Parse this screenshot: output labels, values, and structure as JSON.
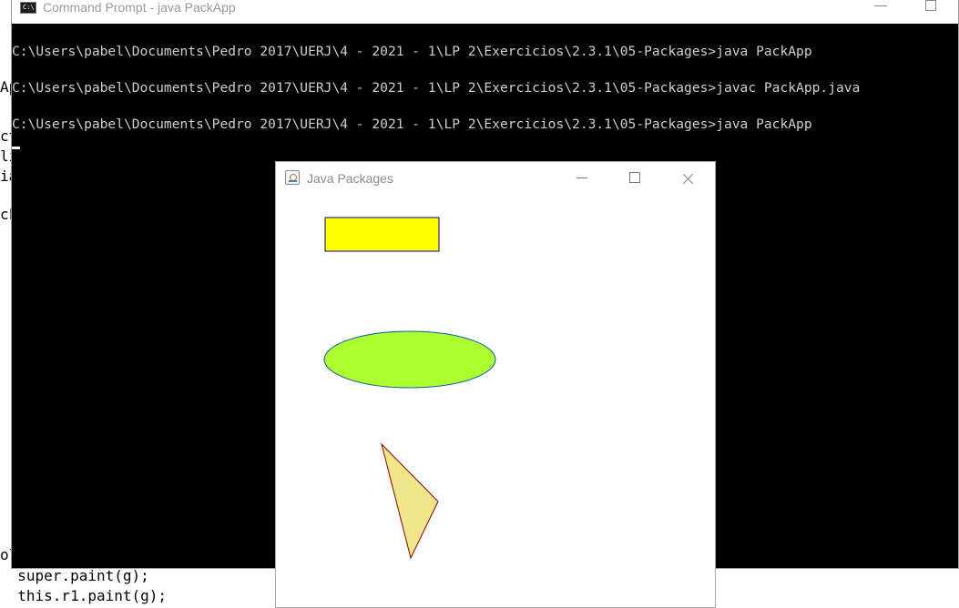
{
  "background_editor": {
    "lines": [
      {
        "text": "Ap"
      },
      {
        "text": "ct"
      },
      {
        "text": "li"
      },
      {
        "text": "ia"
      },
      {
        "text": "ck"
      },
      {
        "text": "ol"
      },
      {
        "text": "  super.paint(g);"
      },
      {
        "text": "  this.r1.paint(g);"
      }
    ]
  },
  "cmd_window": {
    "title": "Command Prompt - java  PackApp",
    "icon_label": "C:\\",
    "lines": [
      "C:\\Users\\pabel\\Documents\\Pedro 2017\\UERJ\\4 - 2021 - 1\\LP 2\\Exercicios\\2.3.1\\05-Packages>java PackApp",
      "C:\\Users\\pabel\\Documents\\Pedro 2017\\UERJ\\4 - 2021 - 1\\LP 2\\Exercicios\\2.3.1\\05-Packages>javac PackApp.java",
      "C:\\Users\\pabel\\Documents\\Pedro 2017\\UERJ\\4 - 2021 - 1\\LP 2\\Exercicios\\2.3.1\\05-Packages>java PackApp"
    ]
  },
  "java_window": {
    "title": "Java Packages",
    "shapes": [
      {
        "kind": "rectangle",
        "fill": "#ffff00",
        "stroke": "#000080"
      },
      {
        "kind": "ellipse",
        "fill": "#adff2f",
        "stroke": "#0b5aa8"
      },
      {
        "kind": "triangle",
        "fill": "#f0e68c",
        "stroke": "#8b0000"
      }
    ]
  }
}
